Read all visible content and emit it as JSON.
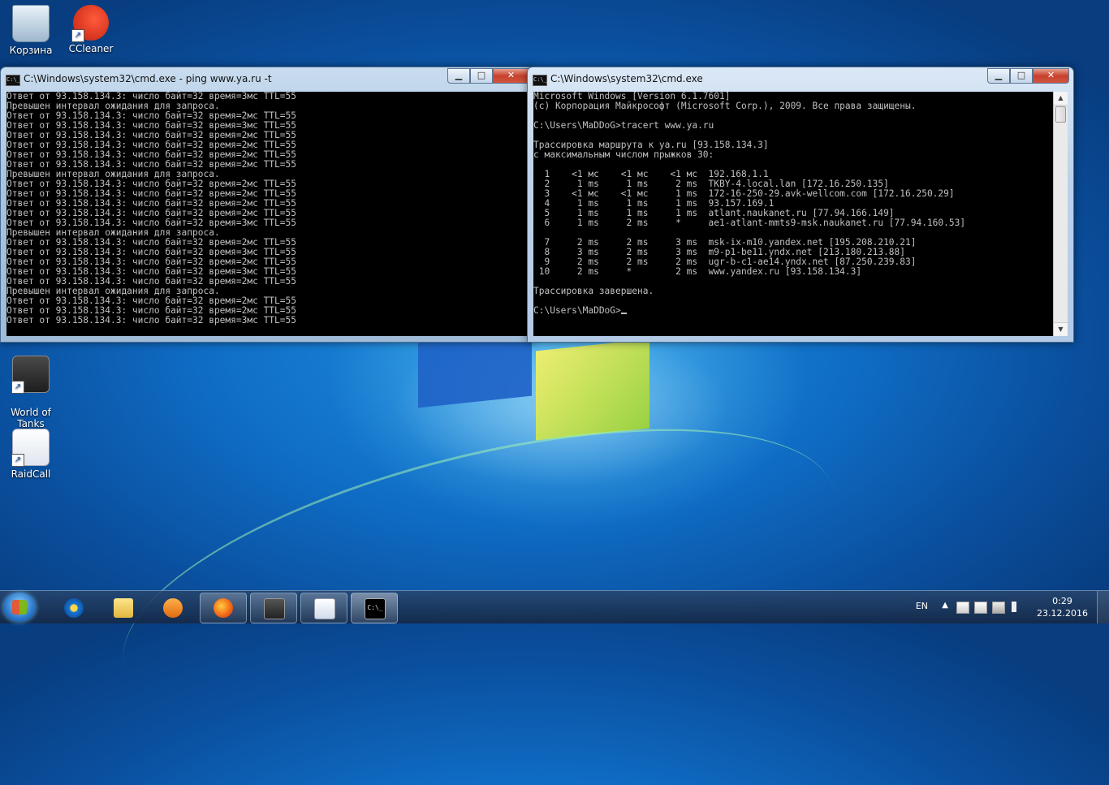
{
  "desktop": {
    "icons": [
      {
        "label": "Корзина"
      },
      {
        "label": "CCleaner"
      },
      {
        "label": "World of\nTanks"
      },
      {
        "label": "RaidCall"
      }
    ]
  },
  "window_ping": {
    "title": "C:\\Windows\\system32\\cmd.exe - ping  www.ya.ru -t",
    "lines": [
      "Ответ от 93.158.134.3: число байт=32 время=3мс TTL=55",
      "Превышен интервал ожидания для запроса.",
      "Ответ от 93.158.134.3: число байт=32 время=2мс TTL=55",
      "Ответ от 93.158.134.3: число байт=32 время=3мс TTL=55",
      "Ответ от 93.158.134.3: число байт=32 время=2мс TTL=55",
      "Ответ от 93.158.134.3: число байт=32 время=2мс TTL=55",
      "Ответ от 93.158.134.3: число байт=32 время=2мс TTL=55",
      "Ответ от 93.158.134.3: число байт=32 время=2мс TTL=55",
      "Превышен интервал ожидания для запроса.",
      "Ответ от 93.158.134.3: число байт=32 время=2мс TTL=55",
      "Ответ от 93.158.134.3: число байт=32 время=2мс TTL=55",
      "Ответ от 93.158.134.3: число байт=32 время=2мс TTL=55",
      "Ответ от 93.158.134.3: число байт=32 время=2мс TTL=55",
      "Ответ от 93.158.134.3: число байт=32 время=3мс TTL=55",
      "Превышен интервал ожидания для запроса.",
      "Ответ от 93.158.134.3: число байт=32 время=2мс TTL=55",
      "Ответ от 93.158.134.3: число байт=32 время=3мс TTL=55",
      "Ответ от 93.158.134.3: число байт=32 время=2мс TTL=55",
      "Ответ от 93.158.134.3: число байт=32 время=3мс TTL=55",
      "Ответ от 93.158.134.3: число байт=32 время=2мс TTL=55",
      "Превышен интервал ожидания для запроса.",
      "Ответ от 93.158.134.3: число байт=32 время=2мс TTL=55",
      "Ответ от 93.158.134.3: число байт=32 время=2мс TTL=55",
      "Ответ от 93.158.134.3: число байт=32 время=3мс TTL=55"
    ]
  },
  "window_tracert": {
    "title": "C:\\Windows\\system32\\cmd.exe",
    "lines": [
      "Microsoft Windows [Version 6.1.7601]",
      "(c) Корпорация Майкрософт (Microsoft Corp.), 2009. Все права защищены.",
      "",
      "C:\\Users\\MaDDoG>tracert www.ya.ru",
      "",
      "Трассировка маршрута к ya.ru [93.158.134.3]",
      "с максимальным числом прыжков 30:",
      "",
      "  1    <1 мс    <1 мс    <1 мс  192.168.1.1",
      "  2     1 ms     1 ms     2 ms  TKBY-4.local.lan [172.16.250.135]",
      "  3    <1 мс    <1 мс     1 ms  172-16-250-29.avk-wellcom.com [172.16.250.29]",
      "  4     1 ms     1 ms     1 ms  93.157.169.1",
      "  5     1 ms     1 ms     1 ms  atlant.naukanet.ru [77.94.166.149]",
      "  6     1 ms     2 ms     *     ae1-atlant-mmts9-msk.naukanet.ru [77.94.160.53]",
      "",
      "  7     2 ms     2 ms     3 ms  msk-ix-m10.yandex.net [195.208.210.21]",
      "  8     3 ms     2 ms     3 ms  m9-p1-be11.yndx.net [213.180.213.88]",
      "  9     2 ms     2 ms     2 ms  ugr-b-c1-ae14.yndx.net [87.250.239.83]",
      " 10     2 ms     *        2 ms  www.yandex.ru [93.158.134.3]",
      "",
      "Трассировка завершена.",
      ""
    ],
    "prompt": "C:\\Users\\MaDDoG>"
  },
  "window_controls": {
    "minimize": "▁",
    "maximize": "□",
    "close": "✕"
  },
  "taskbar": {
    "lang": "EN",
    "time": "0:29",
    "date": "23.12.2016",
    "apps": [
      "internet-explorer-icon",
      "explorer-folder-icon",
      "media-player-icon",
      "firefox-icon",
      "world-of-tanks-icon",
      "raidcall-icon",
      "cmd-icon"
    ]
  },
  "icon_glyphs": {
    "cmd": "C:\\_",
    "shortcut": "↗",
    "tray_chevron": "▲"
  },
  "colors": {
    "console_bg": "#000000",
    "console_fg": "#c0c0c0",
    "close_red": "#c7402c"
  }
}
